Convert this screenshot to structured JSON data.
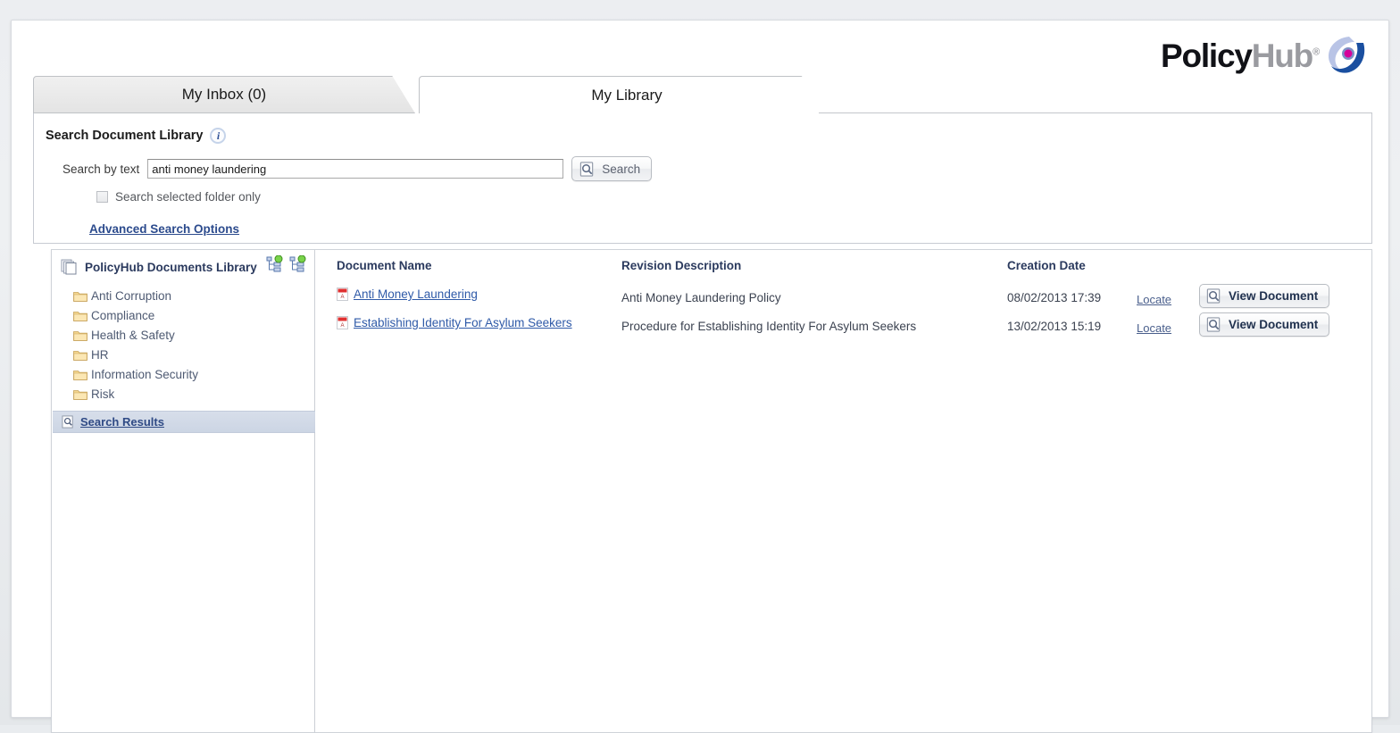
{
  "brand": {
    "logo_policy": "Policy",
    "logo_hub": "Hub",
    "logo_tm": "®",
    "accent_blue": "#2f5aa8",
    "accent_magenta": "#d6009a"
  },
  "tabs": [
    {
      "label": "My Inbox (0)",
      "active": false
    },
    {
      "label": "My Library",
      "active": true
    }
  ],
  "search_panel": {
    "title": "Search Document Library",
    "info_glyph": "i",
    "search_by_text_label": "Search by text",
    "search_value": "anti money laundering",
    "search_placeholder": "",
    "search_button_label": "Search",
    "checkbox_label": "Search selected folder only",
    "checkbox_checked": false,
    "advanced_link": "Advanced Search Options"
  },
  "tree": {
    "root_label": "PolicyHub Documents Library",
    "folders": [
      {
        "label": "Anti Corruption"
      },
      {
        "label": "Compliance"
      },
      {
        "label": "Health & Safety"
      },
      {
        "label": "HR"
      },
      {
        "label": "Information Security"
      },
      {
        "label": "Risk"
      }
    ],
    "search_results_label": "Search Results"
  },
  "results": {
    "columns": {
      "document_name": "Document Name",
      "revision_description": "Revision Description",
      "creation_date": "Creation Date"
    },
    "locate_label": "Locate",
    "view_button_label": "View Document",
    "rows": [
      {
        "document_name": "Anti Money Laundering",
        "revision_description": "Anti Money Laundering Policy",
        "creation_date": "08/02/2013 17:39"
      },
      {
        "document_name": "Establishing Identity For Asylum Seekers",
        "revision_description": "Procedure for Establishing Identity For Asylum Seekers",
        "creation_date": "13/02/2013 15:19"
      }
    ]
  }
}
